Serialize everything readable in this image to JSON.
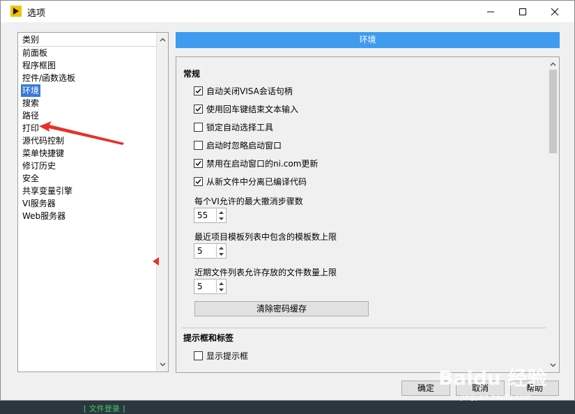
{
  "window": {
    "title": "选项"
  },
  "sidebar": {
    "header": "类别",
    "items": [
      {
        "label": "前面板"
      },
      {
        "label": "程序框图"
      },
      {
        "label": "控件/函数选板"
      },
      {
        "label": "环境",
        "selected": true
      },
      {
        "label": "搜索"
      },
      {
        "label": "路径"
      },
      {
        "label": "打印"
      },
      {
        "label": "源代码控制"
      },
      {
        "label": "菜单快捷键"
      },
      {
        "label": "修订历史"
      },
      {
        "label": "安全"
      },
      {
        "label": "共享变量引擎"
      },
      {
        "label": "VI服务器"
      },
      {
        "label": "Web服务器"
      }
    ]
  },
  "main": {
    "section_title": "环境",
    "general": {
      "title": "常规",
      "checkboxes": [
        {
          "label": "自动关闭VISA会话句柄",
          "checked": true
        },
        {
          "label": "使用回车键结束文本输入",
          "checked": true
        },
        {
          "label": "锁定自动选择工具",
          "checked": false
        },
        {
          "label": "启动时忽略启动窗口",
          "checked": false
        },
        {
          "label": "禁用在启动窗口的ni.com更新",
          "checked": true
        },
        {
          "label": "从新文件中分离已编译代码",
          "checked": true
        }
      ],
      "undo_label": "每个VI允许的最大撤消步骤数",
      "undo_value": "55",
      "templates_label": "最近项目模板列表中包含的模板数上限",
      "templates_value": "5",
      "files_label": "近期文件列表允许存放的文件数量上限",
      "files_value": "5",
      "clear_button": "清除密码缓存"
    },
    "tips": {
      "title": "提示框和标签",
      "checkboxes": [
        {
          "label": "显示提示框",
          "checked": false
        }
      ]
    }
  },
  "footer": {
    "ok": "确定",
    "cancel": "取消",
    "help": "帮助"
  },
  "watermark": {
    "text": "Baidu 经验",
    "sub": "jingyan.baidu.com"
  },
  "background": {
    "bottom_text": "[ 文件登录 ]"
  },
  "colors": {
    "accent": "#3f9bf0",
    "selection": "#3a78d8",
    "annotation": "#e8302a"
  }
}
